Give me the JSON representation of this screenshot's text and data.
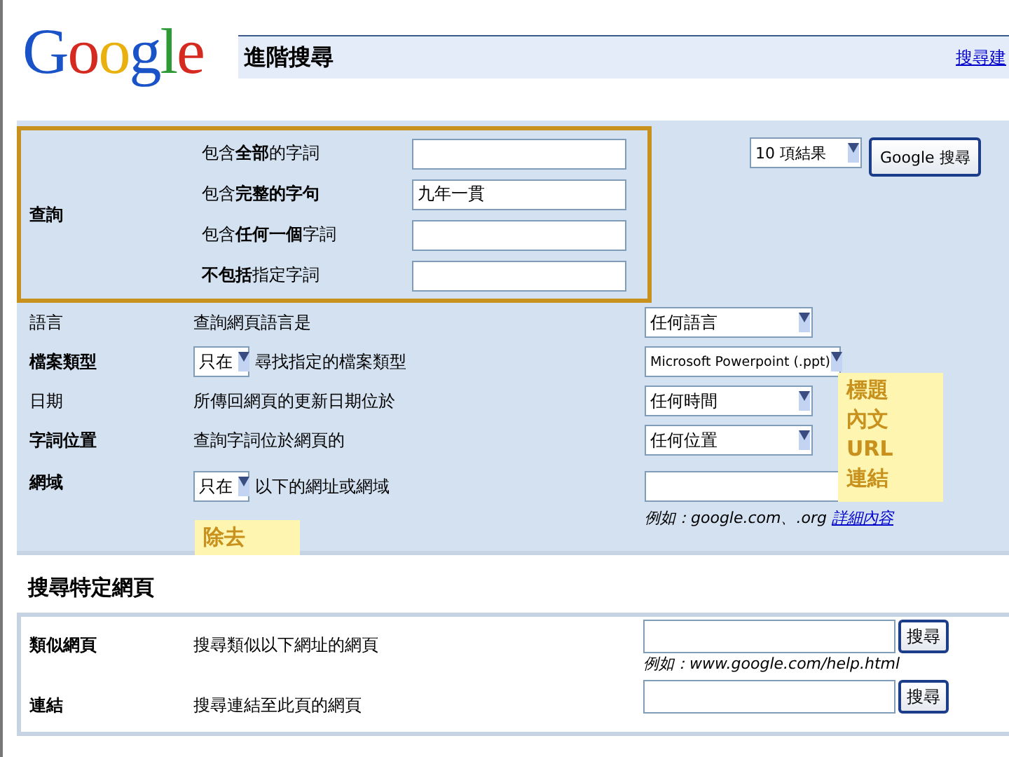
{
  "logo": "Google",
  "header": {
    "title": "進階搜尋",
    "link": "搜尋建"
  },
  "query": {
    "label": "查詢",
    "rows": [
      {
        "text": "包含**全部**的字詞",
        "value": ""
      },
      {
        "text": "包含**完整的字句**",
        "value": "九年一貫"
      },
      {
        "text": "包含**任何一個**字詞",
        "value": ""
      },
      {
        "text": "**不包括**指定字詞",
        "value": ""
      }
    ],
    "results_select": "10 項結果",
    "search_button": "Google 搜尋"
  },
  "options": [
    {
      "kind": "select",
      "label": "語言",
      "text": "查詢網頁語言是",
      "select": "任何語言"
    },
    {
      "kind": "mode",
      "label": "檔案類型",
      "mode": "只在",
      "text": "尋找指定的檔案類型",
      "select": "Microsoft Powerpoint (.ppt)"
    },
    {
      "kind": "select",
      "label": "日期",
      "text": "所傳回網頁的更新日期位於",
      "select": "任何時間"
    },
    {
      "kind": "select",
      "label": "字詞位置",
      "text": "查詢字詞位於網頁的",
      "select": "任何位置"
    },
    {
      "kind": "field",
      "label": "網域",
      "mode": "只在",
      "text": "以下的網址或網域",
      "hint": "例如：google.com、.org",
      "link": "詳細內容"
    }
  ],
  "notes": [
    {
      "lines": [
        "標題",
        "內文",
        "URL",
        "連結"
      ]
    },
    {
      "lines": [
        "除去"
      ]
    }
  ],
  "specific": {
    "title": "搜尋特定網頁",
    "rows": [
      {
        "label": "類似網頁",
        "text": "搜尋類似以下網址的網頁",
        "button": "搜尋",
        "hint": "例如：www.google.com/help.html"
      },
      {
        "label": "連結",
        "text": "搜尋連結至此頁的網頁",
        "button": "搜尋"
      }
    ]
  }
}
